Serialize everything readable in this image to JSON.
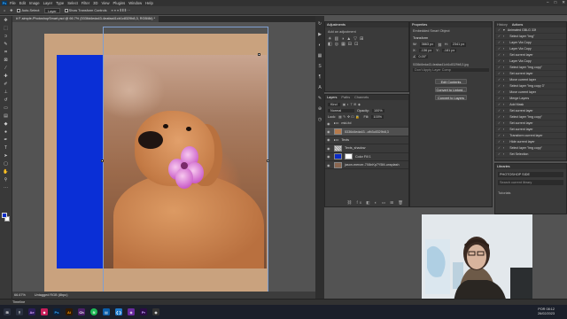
{
  "menubar": {
    "items": [
      "File",
      "Edit",
      "Image",
      "Layer",
      "Type",
      "Select",
      "Filter",
      "3D",
      "View",
      "Plugins",
      "Window",
      "Help"
    ],
    "app_logo": "Ps"
  },
  "options": {
    "auto_select_label": "Auto-Select:",
    "auto_select_value": "Layer",
    "transform_label": "Show Transform Controls"
  },
  "document": {
    "tab_title": "# F-simple-PhotoshopSmart.psd @ 66.7% (5336d4eda43-4eafaa41cb1c8329b8,3, RGB/8#) *",
    "zoom": "66.67%",
    "color_profile": "Untagged RGB (8bpc)"
  },
  "tools": [
    "move-icon",
    "marquee-icon",
    "lasso-icon",
    "quick-select-icon",
    "crop-icon",
    "frame-icon",
    "eyedropper-icon",
    "healing-icon",
    "brush-icon",
    "stamp-icon",
    "history-brush-icon",
    "eraser-icon",
    "gradient-icon",
    "blur-icon",
    "dodge-icon",
    "pen-icon",
    "type-icon",
    "path-select-icon",
    "shape-icon",
    "hand-icon",
    "zoom-icon",
    "more-icon"
  ],
  "colors": {
    "foreground": "#0b2cc7",
    "background": "#ffffff",
    "canvas_blue": "#0a2fd6",
    "accent": "#31a8ff"
  },
  "adjustments": {
    "tabs": [
      "Adjustments"
    ],
    "hint": "Add an adjustment"
  },
  "layers": {
    "tabs": [
      "Layers",
      "Paths",
      "Channels"
    ],
    "kind_label": "Kind",
    "blend_mode": "Normal",
    "opacity_label": "Opacity:",
    "opacity": "100%",
    "lock_label": "Lock:",
    "fill_label": "Fill:",
    "fill": "100%",
    "items": [
      {
        "name": "mid-fol"
      },
      {
        "name": "5336d4eda43...cfb3c8329b8,3"
      },
      {
        "name": "Texts"
      },
      {
        "name": "Texts_shadow"
      },
      {
        "name": "Color Fill 1"
      },
      {
        "name": "jason-mercer-7X8nKp7Y5M-unsplash"
      }
    ]
  },
  "properties": {
    "tabs": [
      "Properties"
    ],
    "type": "Embedded Smart Object",
    "section": "Transform",
    "w_label": "W:",
    "w_value": "3663 px",
    "h_label": "H:",
    "h_value": "2341 px",
    "x_label": "X:",
    "x_value": "-136 px",
    "y_label": "Y:",
    "y_value": "-181 px",
    "angle": "0.00°",
    "filename": "5336d4eda43-4eafaa41cb1c8329b8,3.jpg",
    "comps_placeholder": "Don't Apply Layer Comp",
    "buttons": [
      "Edit Contents",
      "Convert to Linked...",
      "Convert to Layers"
    ]
  },
  "actions": {
    "tabs": [
      "History",
      "Actions"
    ],
    "items": [
      "Animated GBLG 33f",
      "Select layer \"img\"",
      "Layer Via Copy",
      "Layer Via Copy",
      "Set current layer",
      "Layer Via Copy",
      "Select layer \"img copy\"",
      "Set current layer",
      "Move current layer",
      "Select layer \"img copy 3\"",
      "Move current layer",
      "Merge Layers",
      "Add Mask",
      "Set current layer",
      "Select layer \"img copy\"",
      "Set current layer",
      "Set current layer",
      "Transform current layer",
      "Hide current layer",
      "Select layer \"img copy\"",
      "Set Selection"
    ]
  },
  "libraries": {
    "tabs": [
      "Libraries"
    ],
    "library": "PHOTOSHOP SIDE",
    "search_placeholder": "Search current library",
    "group": "Tutorials"
  },
  "status": {
    "zoom": "66.67%",
    "info": "Untagged RGB (8bpc)"
  },
  "timeline": {
    "label": "Timeline"
  },
  "taskbar": {
    "apps": [
      "Ae",
      "Ps",
      "Ai",
      "Ch",
      "Sp",
      "Fi",
      "VS",
      "Dr",
      "Pr"
    ],
    "time": "08:12",
    "date": "26/02/2023",
    "lang": "POR"
  }
}
